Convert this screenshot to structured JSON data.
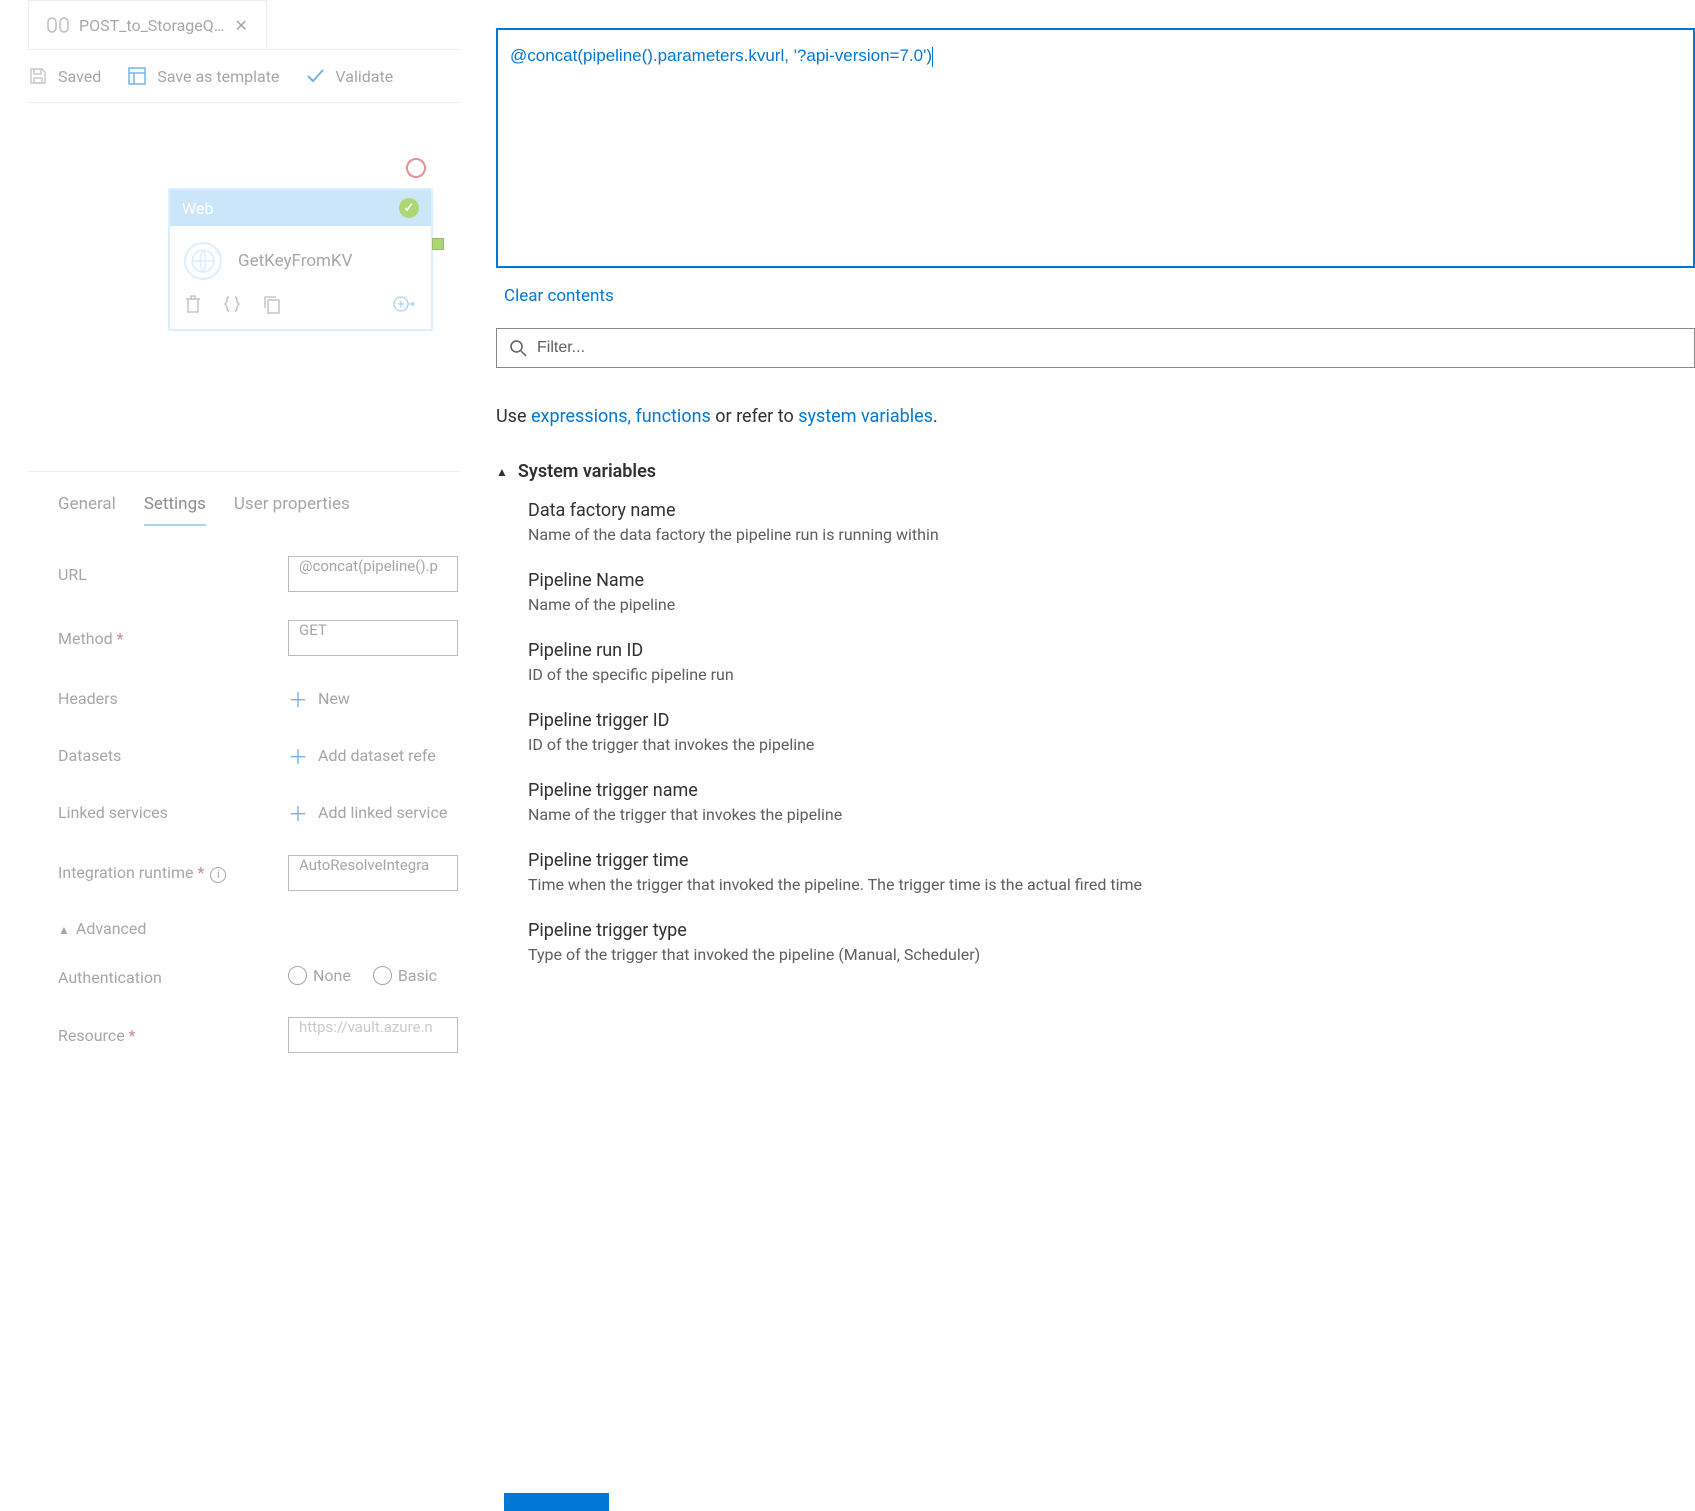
{
  "tab": {
    "title": "POST_to_StorageQ…"
  },
  "toolbar": {
    "saved": "Saved",
    "save_template": "Save as template",
    "validate": "Validate"
  },
  "activity": {
    "type": "Web",
    "name": "GetKeyFromKV"
  },
  "detail_tabs": {
    "general": "General",
    "settings": "Settings",
    "user_props": "User properties"
  },
  "settings": {
    "url_label": "URL",
    "url_value": "@concat(pipeline().p",
    "method_label": "Method",
    "method_required": " *",
    "method_value": "GET",
    "headers_label": "Headers",
    "headers_action": "New",
    "datasets_label": "Datasets",
    "datasets_action": "Add dataset refe",
    "linked_label": "Linked services",
    "linked_action": "Add linked service",
    "runtime_label": "Integration runtime",
    "runtime_required": " *",
    "runtime_value": "AutoResolveIntegra",
    "advanced_label": "Advanced",
    "auth_label": "Authentication",
    "auth_none": "None",
    "auth_basic": "Basic",
    "resource_label": "Resource",
    "resource_required": " *",
    "resource_placeholder": "https://vault.azure.n"
  },
  "expression": {
    "value": "@concat(pipeline().parameters.kvurl, '?api-version=7.0')",
    "clear": "Clear contents",
    "filter_placeholder": "Filter...",
    "hint_prefix": "Use ",
    "hint_link1": "expressions, functions",
    "hint_mid": " or refer to ",
    "hint_link2": "system variables",
    "hint_suffix": "."
  },
  "sysvars": {
    "header": "System variables",
    "items": [
      {
        "name": "Data factory name",
        "desc": "Name of the data factory the pipeline run is running within"
      },
      {
        "name": "Pipeline Name",
        "desc": "Name of the pipeline"
      },
      {
        "name": "Pipeline run ID",
        "desc": "ID of the specific pipeline run"
      },
      {
        "name": "Pipeline trigger ID",
        "desc": "ID of the trigger that invokes the pipeline"
      },
      {
        "name": "Pipeline trigger name",
        "desc": "Name of the trigger that invokes the pipeline"
      },
      {
        "name": "Pipeline trigger time",
        "desc": "Time when the trigger that invoked the pipeline. The trigger time is the actual fired time"
      },
      {
        "name": "Pipeline trigger type",
        "desc": "Type of the trigger that invoked the pipeline (Manual, Scheduler)"
      }
    ]
  }
}
